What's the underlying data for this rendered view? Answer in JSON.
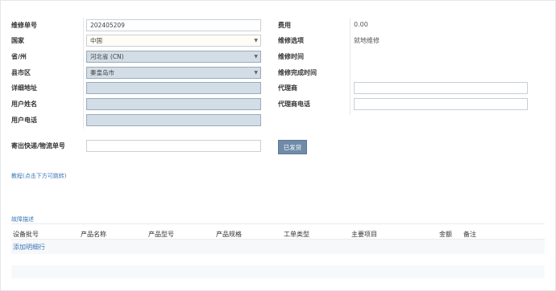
{
  "form": {
    "repair_no": {
      "label": "维修单号",
      "value": "202405209"
    },
    "country": {
      "label": "国家",
      "value": "中国"
    },
    "province": {
      "label": "省/州",
      "value": "河北省 (CN)"
    },
    "city": {
      "label": "县市区",
      "value": "秦皇岛市"
    },
    "address": {
      "label": "详细地址",
      "value": ""
    },
    "user_name": {
      "label": "用户姓名",
      "value": ""
    },
    "user_phone": {
      "label": "用户电话",
      "value": ""
    },
    "express_no": {
      "label": "寄出快递/物流单号",
      "value": ""
    },
    "shipped_button": "已发货"
  },
  "right": {
    "fee": {
      "label": "费用",
      "value": "0.00"
    },
    "repair_option": {
      "label": "维修选项",
      "value": "就地维修"
    },
    "repair_time": {
      "label": "维修时间",
      "value": ""
    },
    "finish_time": {
      "label": "维修完成时间",
      "value": ""
    },
    "agent": {
      "label": "代理商",
      "value": ""
    },
    "agent_phone": {
      "label": "代理商电话",
      "value": ""
    }
  },
  "tutorial_link": "教程(点击下方可跳转)",
  "fault_section": "故障描述",
  "table": {
    "headers": [
      "设备批号",
      "产品名称",
      "产品型号",
      "产品规格",
      "工单类型",
      "主要项目",
      "金额",
      "备注"
    ],
    "add_row": "添加明细行"
  }
}
